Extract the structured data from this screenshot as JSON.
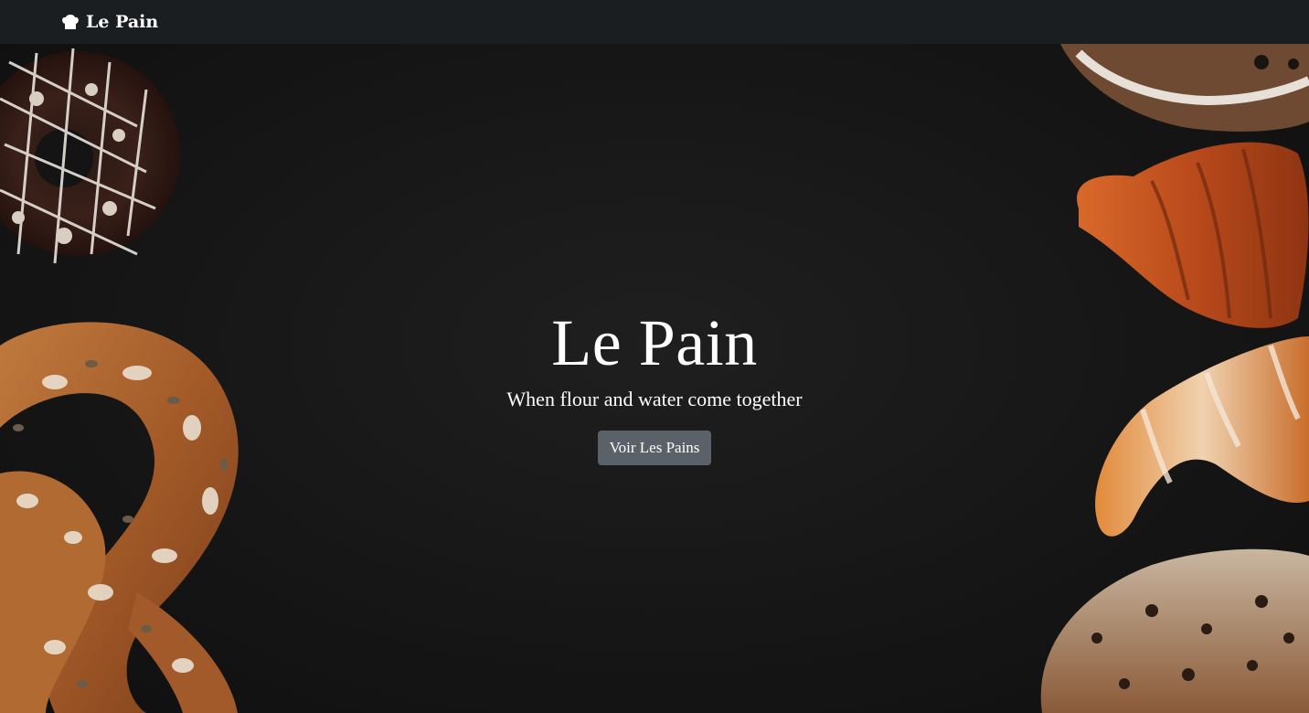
{
  "navbar": {
    "brand_icon": "chef-hat-icon",
    "brand_text": "Le Pain"
  },
  "hero": {
    "title": "Le Pain",
    "subtitle": "When flour and water come together",
    "button_label": "Voir Les Pains"
  },
  "colors": {
    "navbar_bg": "#1b1e21",
    "hero_bg": "#141414",
    "button_bg": "#5a6168",
    "text": "#ffffff"
  },
  "decorations": [
    "donut-image",
    "pretzel-image",
    "pastry-image",
    "croissant-image",
    "bread-roll-image",
    "raisin-loaf-image"
  ]
}
